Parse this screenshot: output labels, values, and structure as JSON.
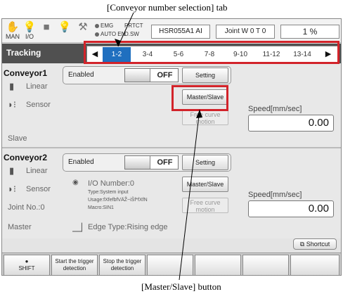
{
  "callouts": {
    "top": "[Conveyor number selection] tab",
    "bottom": "[Master/Slave] button"
  },
  "topbar": {
    "icons": [
      {
        "glyph": "✋",
        "label": "MAN",
        "name": "hand-icon"
      },
      {
        "glyph": "💡",
        "label": "I/O",
        "name": "io-lamp-icon"
      },
      {
        "glyph": "■",
        "label": "",
        "name": "stop-icon"
      },
      {
        "glyph": "💡",
        "label": "",
        "name": "lamp-icon"
      },
      {
        "glyph": "⚒",
        "label": "",
        "name": "tool-icon"
      }
    ],
    "status": [
      "EMG",
      "AUTO EN",
      "PRTCT",
      "D.SW"
    ],
    "robot": "HSR055A1 AI",
    "joint": "Joint W 0 T 0",
    "override": "1 %"
  },
  "tracking": {
    "title": "Tracking",
    "tabs": [
      "1-2",
      "3-4",
      "5-6",
      "7-8",
      "9-10",
      "11-12",
      "13-14"
    ],
    "active_tab": "1-2"
  },
  "conveyor1": {
    "title": "Conveyor1",
    "type": "Linear",
    "sensor": "Sensor",
    "role": "Slave",
    "enabled_label": "Enabled",
    "toggle": "OFF",
    "setting": "Setting",
    "master_slave": "Master/Slave",
    "free_curve_1": "Free curve",
    "free_curve_2": "motion",
    "speed_label": "Speed[mm/sec]",
    "speed": "0.00"
  },
  "conveyor2": {
    "title": "Conveyor2",
    "type": "Linear",
    "sensor": "Sensor",
    "joint_no": "Joint No.:0",
    "role": "Master",
    "edge_type": "Edge Type:Rising edge",
    "enabled_label": "Enabled",
    "toggle": "OFF",
    "setting": "Setting",
    "master_slave": "Master/Slave",
    "free_curve_1": "Free curve",
    "free_curve_2": "motion",
    "io_number": "I/O Number:0",
    "io_type": "Type:System input",
    "io_usage": "Usage:fXfefbfVÄŽ~iŠf*fXfN",
    "io_macro": "Macro:SIN1",
    "speed_label": "Speed[mm/sec]",
    "speed": "0.00"
  },
  "shortcut": "Shortcut",
  "footer": {
    "shift": "SHIFT",
    "start_1": "Start the trigger",
    "start_2": "detection",
    "stop_1": "Stop the trigger",
    "stop_2": "detection"
  }
}
